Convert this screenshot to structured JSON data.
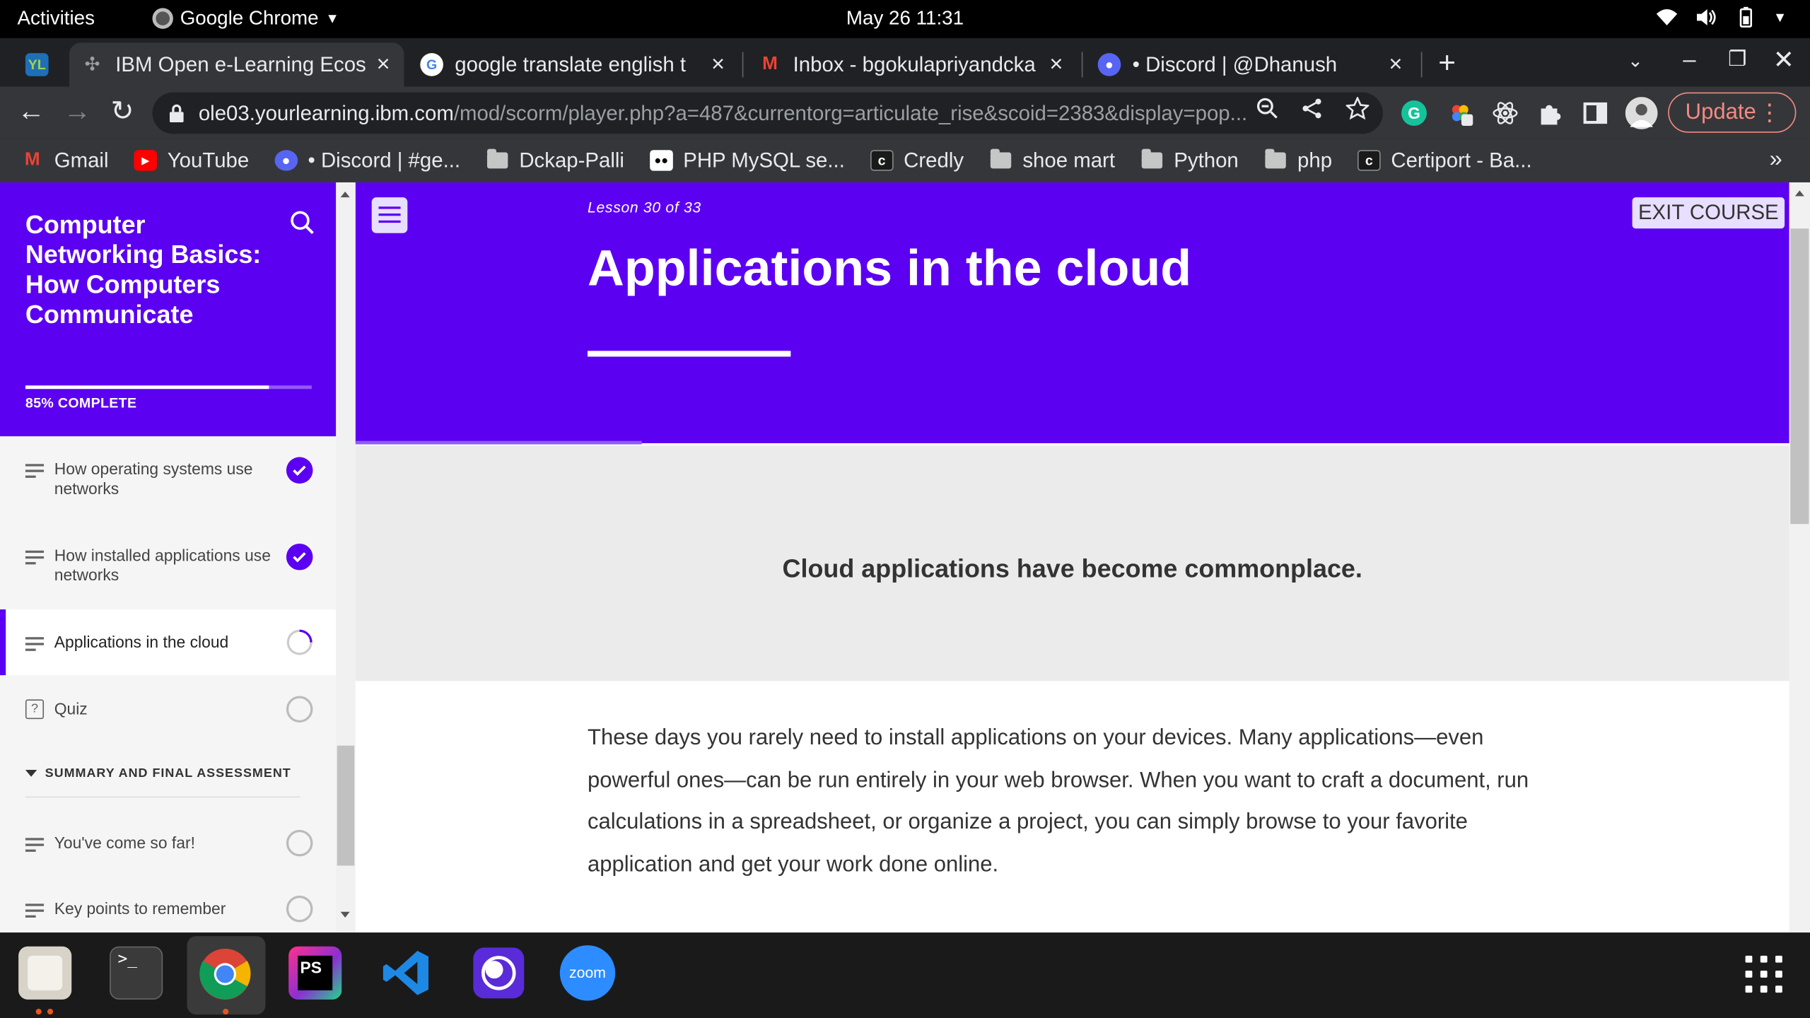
{
  "topbar": {
    "activities": "Activities",
    "app_name": "Google Chrome",
    "clock": "May 26  11:31"
  },
  "tabs": [
    {
      "title": "IBM Open e-Learning Ecos",
      "active": true
    },
    {
      "title": "google translate english t",
      "active": false
    },
    {
      "title": "Inbox - bgokulapriyandcka",
      "active": false
    },
    {
      "title": "• Discord | @Dhanush",
      "active": false
    }
  ],
  "omnibox": {
    "host": "ole03.yourlearning.ibm.com",
    "path": "/mod/scorm/player.php?a=487&currentorg=articulate_rise&scoid=2383&display=pop..."
  },
  "update_label": "Update",
  "bookmarks": [
    {
      "label": "Gmail",
      "icon": "gmail-icon"
    },
    {
      "label": "YouTube",
      "icon": "youtube-icon"
    },
    {
      "label": "• Discord | #ge...",
      "icon": "discord-icon"
    },
    {
      "label": "Dckap-Palli",
      "icon": "folder-icon"
    },
    {
      "label": "PHP MySQL se...",
      "icon": "medium-icon"
    },
    {
      "label": "Credly",
      "icon": "credly-icon"
    },
    {
      "label": "shoe mart",
      "icon": "folder-icon"
    },
    {
      "label": "Python",
      "icon": "folder-icon"
    },
    {
      "label": "php",
      "icon": "folder-icon"
    },
    {
      "label": "Certiport - Ba...",
      "icon": "credly-icon"
    }
  ],
  "bookmarks_more": "»",
  "sidebar": {
    "course_title": "Computer Networking Basics: How Computers Communicate",
    "progress_percent": 85,
    "progress_label": "85% COMPLETE",
    "items": [
      {
        "label": "How operating systems use networks",
        "status": "done"
      },
      {
        "label": "How installed applications use networks",
        "status": "done"
      },
      {
        "label": "Applications in the cloud",
        "status": "in-progress"
      },
      {
        "label": "Quiz",
        "status": "not-started"
      }
    ],
    "section_label": "SUMMARY AND FINAL ASSESSMENT",
    "section_items": [
      {
        "label": "You've come so far!",
        "status": "not-started"
      },
      {
        "label": "Key points to remember",
        "status": "not-started"
      }
    ]
  },
  "lesson": {
    "counter": "Lesson 30 of 33",
    "title": "Applications in the cloud",
    "exit_label": "EXIT COURSE",
    "callout": "Cloud applications have become commonplace.",
    "body": "These days you rarely need to install applications on your devices. Many applications—even powerful ones—can be run entirely in your web browser. When you want to craft a document, run calculations in a spreadsheet, or organize a project, you can simply browse to your favorite application and get your work done online."
  },
  "dock": {
    "zoom_label": "zoom",
    "apps": [
      "files-icon",
      "terminal-icon",
      "chrome-icon",
      "phpstorm-icon",
      "vscode-icon",
      "unknown-app-icon",
      "zoom-icon"
    ]
  },
  "colors": {
    "accent": "#5c00f2",
    "callout_bg": "#ebebeb"
  }
}
